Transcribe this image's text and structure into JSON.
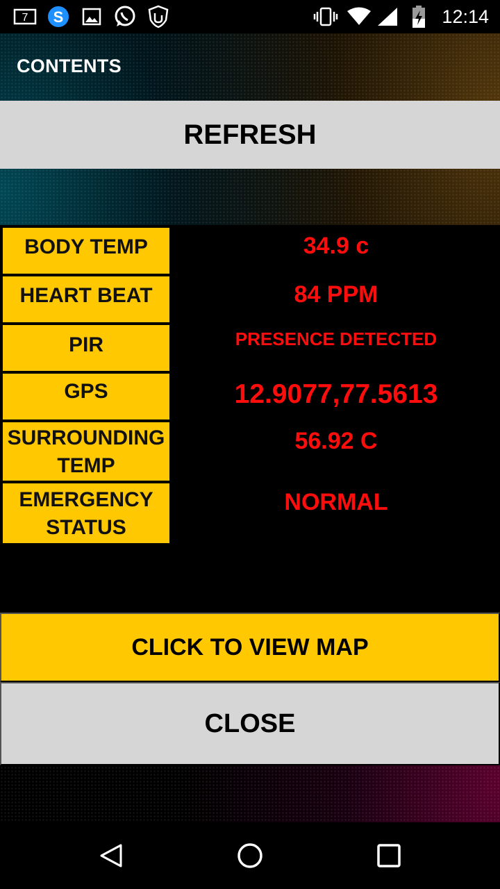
{
  "status_bar": {
    "time": "12:14",
    "notification_icons": [
      "calendar-icon",
      "skype-icon",
      "image-icon",
      "whatsapp-icon",
      "hand-shield-icon"
    ],
    "calendar_day": "7",
    "system_icons": [
      "vibrate-icon",
      "wifi-icon",
      "signal-icon",
      "battery-charging-icon"
    ]
  },
  "header": {
    "title": "CONTENTS"
  },
  "refresh_button": {
    "label": "REFRESH"
  },
  "readings": [
    {
      "label": [
        "BODY TEMP"
      ],
      "value": "34.9  c"
    },
    {
      "label": [
        "HEART BEAT"
      ],
      "value": "84  PPM"
    },
    {
      "label": [
        "PIR"
      ],
      "value": "PRESENCE DETECTED"
    },
    {
      "label": [
        "GPS"
      ],
      "value": "12.9077,77.5613"
    },
    {
      "label": [
        "SURROUNDING",
        "TEMP"
      ],
      "value": "56.92  C"
    },
    {
      "label": [
        "EMERGENCY",
        "STATUS"
      ],
      "value": "NORMAL"
    }
  ],
  "colors": {
    "label_bg": "#ffc800",
    "value_text": "#ff0d0d",
    "button_gray": "#d6d6d6"
  },
  "map_button": {
    "label": "CLICK TO VIEW MAP"
  },
  "close_button": {
    "label": "CLOSE"
  },
  "nav_bar": {
    "buttons": [
      "back-icon",
      "home-icon",
      "recents-icon"
    ]
  }
}
